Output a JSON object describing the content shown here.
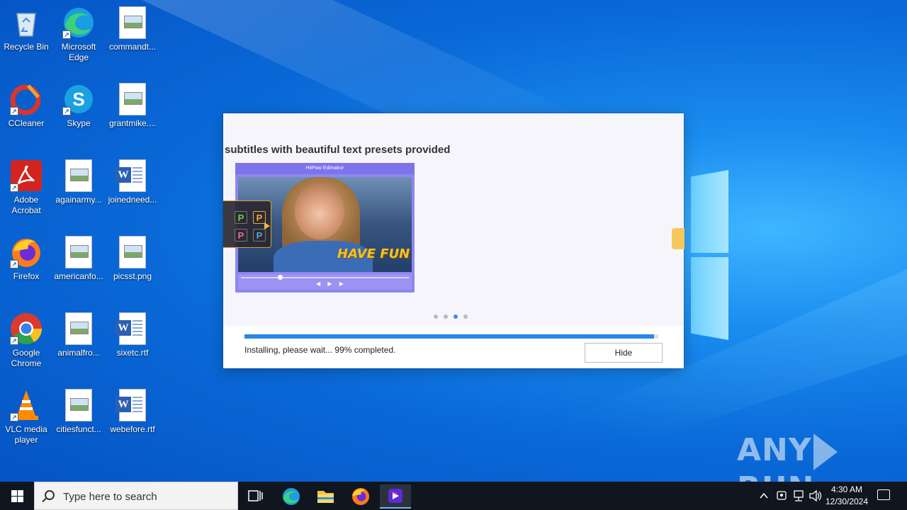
{
  "desktop": {
    "icons": [
      {
        "label": "Recycle Bin"
      },
      {
        "label": "Microsoft Edge"
      },
      {
        "label": "commandt..."
      },
      {
        "label": "CCleaner"
      },
      {
        "label": "Skype"
      },
      {
        "label": "grantmike...."
      },
      {
        "label": "Adobe Acrobat"
      },
      {
        "label": "againarmy..."
      },
      {
        "label": "joinedneed..."
      },
      {
        "label": "Firefox"
      },
      {
        "label": "americanfo..."
      },
      {
        "label": "picsst.png"
      },
      {
        "label": "Google Chrome"
      },
      {
        "label": "animalfro..."
      },
      {
        "label": "sixetc.rtf"
      },
      {
        "label": "VLC media player"
      },
      {
        "label": "citiesfunct..."
      },
      {
        "label": "webefore.rtf"
      }
    ]
  },
  "installer": {
    "slide_title": "subtitles with beautiful text presets provided",
    "preview_app_title": "HitPaw Edimakor",
    "preview_caption": "HAVE FUN",
    "preset_letter": "P",
    "carousel": {
      "count": 4,
      "active_index": 2
    },
    "progress_percent": 99,
    "status_text": "Installing, please wait... 99% completed.",
    "hide_label": "Hide",
    "accent": "#2788e8"
  },
  "watermark": {
    "brand": "ANY",
    "brand2": "RUN"
  },
  "taskbar": {
    "search_placeholder": "Type here to search",
    "time": "4:30 AM",
    "date": "12/30/2024"
  }
}
